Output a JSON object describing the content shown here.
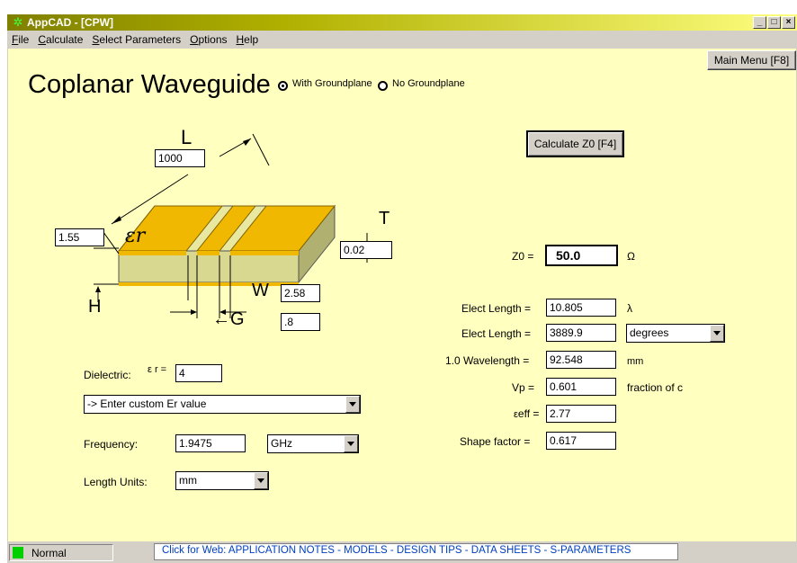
{
  "window": {
    "title": "AppCAD - [CPW]",
    "minimize": "_",
    "maximize": "□",
    "close": "×"
  },
  "menu": [
    {
      "u": "F",
      "rest": "ile"
    },
    {
      "u": "C",
      "rest": "alculate"
    },
    {
      "u": "S",
      "rest": "elect Parameters"
    },
    {
      "u": "O",
      "rest": "ptions"
    },
    {
      "u": "H",
      "rest": "elp"
    }
  ],
  "header": {
    "main_menu": "Main Menu [F8]",
    "page_title": "Coplanar Waveguide",
    "radio_ground": "With Groundplane",
    "radio_noground": "No Groundplane",
    "ground_selected": true
  },
  "diagram": {
    "label_L": "L",
    "label_T": "T",
    "label_H": "H",
    "label_W": "W",
    "label_G": "G",
    "label_er": "εr",
    "L_value": "1000",
    "H_value": "1.55",
    "T_value": "0.02",
    "W_value": "2.58",
    "G_value": ".8"
  },
  "inputs": {
    "dielectric_label": "Dielectric:",
    "er_symbol": "ε r =",
    "er_value": "4",
    "material_select": "-> Enter custom Er value",
    "frequency_label": "Frequency:",
    "frequency_value": "1.9475",
    "frequency_unit": "GHz",
    "length_units_label": "Length Units:",
    "length_units_value": "mm"
  },
  "calculate_button": "Calculate Z0  [F4]",
  "results": {
    "z0_label": "Z0 =",
    "z0_value": "50.0",
    "z0_unit": "Ω",
    "elect_len1_label": "Elect Length =",
    "elect_len1_value": "10.805",
    "elect_len1_unit": "λ",
    "elect_len2_label": "Elect Length =",
    "elect_len2_value": "3889.9",
    "elect_len2_unit": "degrees",
    "wavelength_label": "1.0 Wavelength =",
    "wavelength_value": "92.548",
    "wavelength_unit": "mm",
    "vp_label": "Vp =",
    "vp_value": "0.601",
    "vp_unit": "fraction of c",
    "eeff_symbol": "ε",
    "eeff_sub": "eff =",
    "eeff_value": "2.77",
    "shape_label": "Shape factor =",
    "shape_value": "0.617"
  },
  "status": {
    "mode": "Normal",
    "web_link": "Click for Web: APPLICATION NOTES - MODELS - DESIGN TIPS - DATA SHEETS - S-PARAMETERS"
  },
  "colors": {
    "client_bg": "#ffffc0",
    "conductor": "#f0b800",
    "substrate": "#d8d890",
    "status_green": "#00d000",
    "link": "#0040c0"
  }
}
